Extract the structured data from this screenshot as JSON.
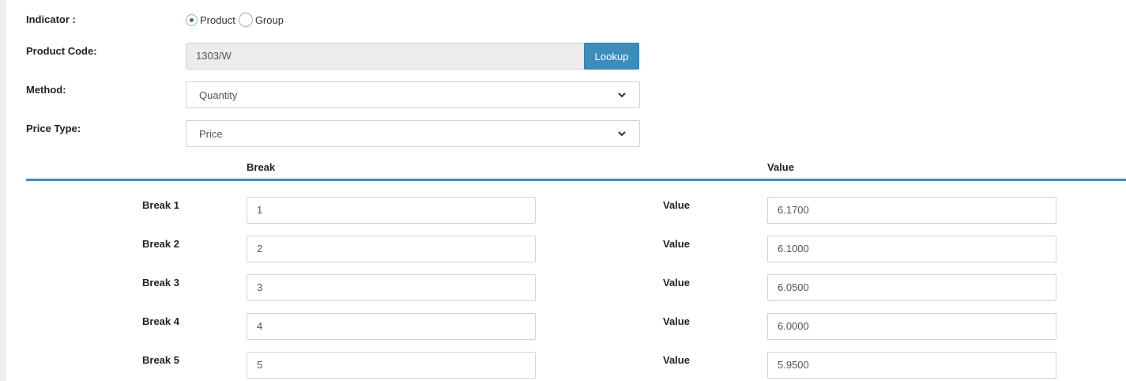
{
  "form": {
    "indicator_label": "Indicator :",
    "indicator_options": [
      {
        "label": "Product",
        "checked": true
      },
      {
        "label": "Group",
        "checked": false
      }
    ],
    "product_code_label": "Product Code:",
    "product_code_value": "1303/W",
    "lookup_button": "Lookup",
    "method_label": "Method:",
    "method_value": "Quantity",
    "price_type_label": "Price Type:",
    "price_type_value": "Price"
  },
  "table": {
    "break_header": "Break",
    "value_header": "Value",
    "rows": [
      {
        "break_label": "Break 1",
        "break_value": "1",
        "value_label": "Value",
        "value": "6.1700"
      },
      {
        "break_label": "Break 2",
        "break_value": "2",
        "value_label": "Value",
        "value": "6.1000"
      },
      {
        "break_label": "Break 3",
        "break_value": "3",
        "value_label": "Value",
        "value": "6.0500"
      },
      {
        "break_label": "Break 4",
        "break_value": "4",
        "value_label": "Value",
        "value": "6.0000"
      },
      {
        "break_label": "Break 5",
        "break_value": "5",
        "value_label": "Value",
        "value": "5.9500"
      }
    ]
  },
  "colors": {
    "accent": "#3c8dbc",
    "readonly_bg": "#ececec"
  }
}
